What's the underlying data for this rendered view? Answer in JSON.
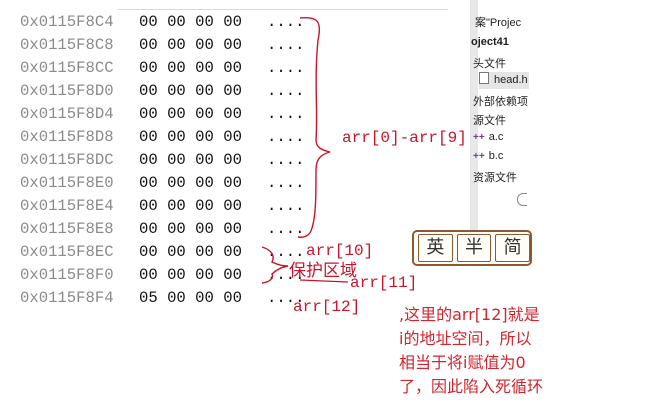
{
  "memory": {
    "rows": [
      {
        "addr": "0x0115F8C4",
        "bytes": "00 00 00 00",
        "ascii": "...."
      },
      {
        "addr": "0x0115F8C8",
        "bytes": "00 00 00 00",
        "ascii": "...."
      },
      {
        "addr": "0x0115F8CC",
        "bytes": "00 00 00 00",
        "ascii": "...."
      },
      {
        "addr": "0x0115F8D0",
        "bytes": "00 00 00 00",
        "ascii": "...."
      },
      {
        "addr": "0x0115F8D4",
        "bytes": "00 00 00 00",
        "ascii": "...."
      },
      {
        "addr": "0x0115F8D8",
        "bytes": "00 00 00 00",
        "ascii": "...."
      },
      {
        "addr": "0x0115F8DC",
        "bytes": "00 00 00 00",
        "ascii": "...."
      },
      {
        "addr": "0x0115F8E0",
        "bytes": "00 00 00 00",
        "ascii": "...."
      },
      {
        "addr": "0x0115F8E4",
        "bytes": "00 00 00 00",
        "ascii": "...."
      },
      {
        "addr": "0x0115F8E8",
        "bytes": "00 00 00 00",
        "ascii": "...."
      },
      {
        "addr": "0x0115F8EC",
        "bytes": "00 00 00 00",
        "ascii": "...."
      },
      {
        "addr": "0x0115F8F0",
        "bytes": "00 00 00 00",
        "ascii": "...."
      },
      {
        "addr": "0x0115F8F4",
        "bytes": "05 00 00 00",
        "ascii": "...."
      }
    ]
  },
  "solution_explorer": {
    "solution": "案\"Projec",
    "project": "oject41",
    "headers_folder": "头文件",
    "header_file": "head.h",
    "external_deps": "外部依赖项",
    "source_folder": "源文件",
    "source_a": "a.c",
    "source_b": "b.c",
    "resource_folder": "资源文件",
    "file_icon_glyph": "++"
  },
  "ime": {
    "keys": [
      "英",
      "半",
      "简"
    ]
  },
  "annotations": {
    "arr0_9": "arr[0]-arr[9]",
    "arr10": "arr[10]",
    "protect": "保护区域",
    "arr11": "arr[11]",
    "arr12": "arr[12]",
    "explanation": [
      ",这里的arr[12]就是",
      "i的地址空间，所以",
      "相当于将i赋值为0",
      "了，因此陷入死循环"
    ],
    "color": "#c8152a"
  }
}
